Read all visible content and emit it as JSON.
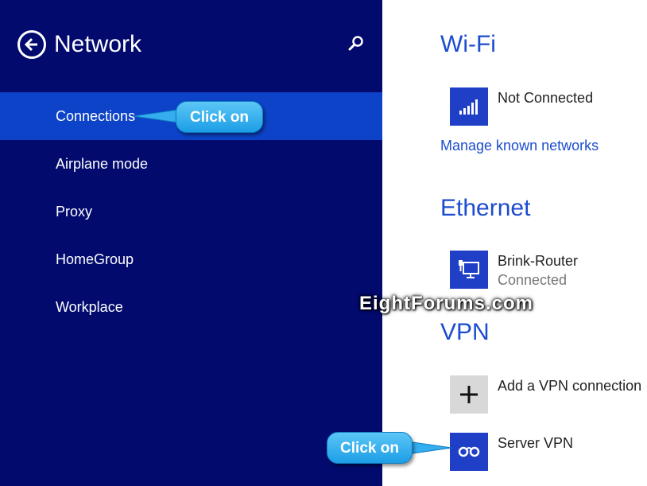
{
  "left_pane": {
    "title": "Network",
    "nav": [
      {
        "label": "Connections",
        "selected": true
      },
      {
        "label": "Airplane mode",
        "selected": false
      },
      {
        "label": "Proxy",
        "selected": false
      },
      {
        "label": "HomeGroup",
        "selected": false
      },
      {
        "label": "Workplace",
        "selected": false
      }
    ],
    "colors": {
      "background": "#020a6e",
      "selected": "#0d43c8"
    }
  },
  "right_pane": {
    "wifi": {
      "heading": "Wi-Fi",
      "network_status": "Not Connected",
      "manage_link": "Manage known networks",
      "icon": "wifi-signal-icon"
    },
    "ethernet": {
      "heading": "Ethernet",
      "network_name": "Brink-Router",
      "network_status": "Connected",
      "icon": "ethernet-icon"
    },
    "vpn": {
      "heading": "VPN",
      "add_label": "Add a VPN connection",
      "add_icon": "plus-icon",
      "server_name": "Server VPN",
      "server_icon": "vpn-icon"
    },
    "colors": {
      "accent": "#1c4ccf",
      "tile": "#1f3fc7"
    }
  },
  "annotations": {
    "callout_1": "Click on",
    "callout_2": "Click on",
    "watermark": "EightForums.com"
  }
}
